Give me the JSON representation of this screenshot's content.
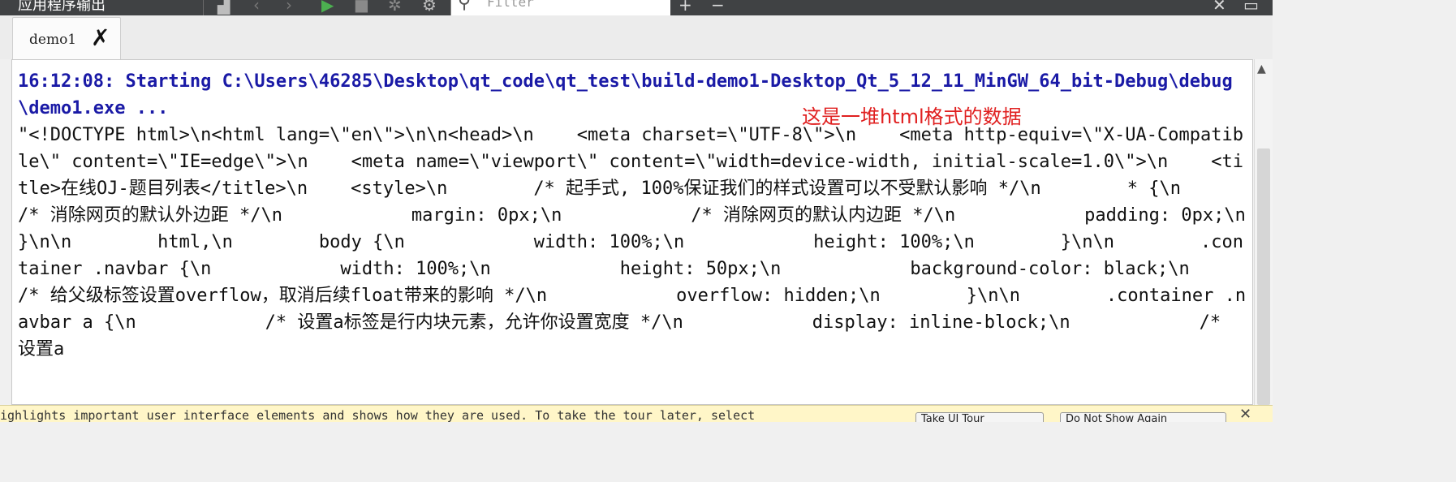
{
  "toolbar": {
    "title": "应用程序输出",
    "filter_placeholder": "Filter"
  },
  "tab": {
    "label": "demo1"
  },
  "output": {
    "start_line": "16:12:08: Starting C:\\Users\\46285\\Desktop\\qt_code\\qt_test\\build-demo1-Desktop_Qt_5_12_11_MinGW_64_bit-Debug\\debug\\demo1.exe ...",
    "text": "\"<!DOCTYPE html>\\n<html lang=\\\"en\\\">\\n\\n<head>\\n    <meta charset=\\\"UTF-8\\\">\\n    <meta http-equiv=\\\"X-UA-Compatible\\\" content=\\\"IE=edge\\\">\\n    <meta name=\\\"viewport\\\" content=\\\"width=device-width, initial-scale=1.0\\\">\\n    <title>在线OJ-题目列表</title>\\n    <style>\\n        /* 起手式, 100%保证我们的样式设置可以不受默认影响 */\\n        * {\\n            /* 消除网页的默认外边距 */\\n            margin: 0px;\\n            /* 消除网页的默认内边距 */\\n            padding: 0px;\\n        }\\n\\n        html,\\n        body {\\n            width: 100%;\\n            height: 100%;\\n        }\\n\\n        .container .navbar {\\n            width: 100%;\\n            height: 50px;\\n            background-color: black;\\n            /* 给父级标签设置overflow，取消后续float带来的影响 */\\n            overflow: hidden;\\n        }\\n\\n        .container .navbar a {\\n            /* 设置a标签是行内块元素，允许你设置宽度 */\\n            display: inline-block;\\n            /* 设置a"
  },
  "annotation": "这是一堆html格式的数据",
  "tour": {
    "message": "ighlights important user interface elements and shows how they are used. To take the tour later, select",
    "take_button": "Take UI Tour",
    "dismiss_button": "Do Not Show Again"
  },
  "colors": {
    "start_line": "#1a1aa6",
    "annotation": "#e02020",
    "toolbar_bg": "#404244"
  }
}
